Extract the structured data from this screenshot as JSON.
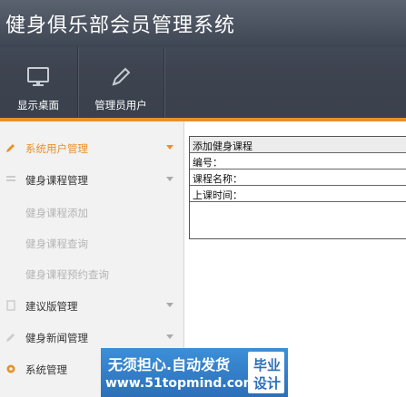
{
  "app": {
    "title": "健身俱乐部会员管理系统"
  },
  "nav": [
    {
      "label": "显示桌面",
      "icon": "monitor-icon"
    },
    {
      "label": "管理员用户",
      "icon": "pencil-icon"
    }
  ],
  "sidebar": {
    "items": [
      {
        "label": "系统用户管理",
        "icon": "pencil-icon",
        "active": true
      },
      {
        "label": "健身课程管理",
        "icon": "list-icon",
        "active": false
      },
      {
        "label": "建议版管理",
        "icon": "document-icon",
        "active": false
      },
      {
        "label": "健身新闻管理",
        "icon": "edit-icon",
        "active": false
      },
      {
        "label": "系统管理",
        "icon": "gear-icon",
        "active": false
      }
    ],
    "sub_items": [
      "健身课程添加",
      "健身课程查询",
      "健身课程预约查询"
    ]
  },
  "form": {
    "title": "添加健身课程",
    "fields": [
      {
        "label": "编号：",
        "value": ""
      },
      {
        "label": "课程名称：",
        "value": ""
      },
      {
        "label": "上课时间：",
        "value": ""
      }
    ]
  },
  "watermark": {
    "line1": "无须担心.自动发货",
    "line2": "www.51topmind.com",
    "badge_line1": "毕业",
    "badge_line2": "设计"
  },
  "colors": {
    "accent": "#e98f2a",
    "header": "#3d4450",
    "watermark": "#2d6fb9"
  }
}
